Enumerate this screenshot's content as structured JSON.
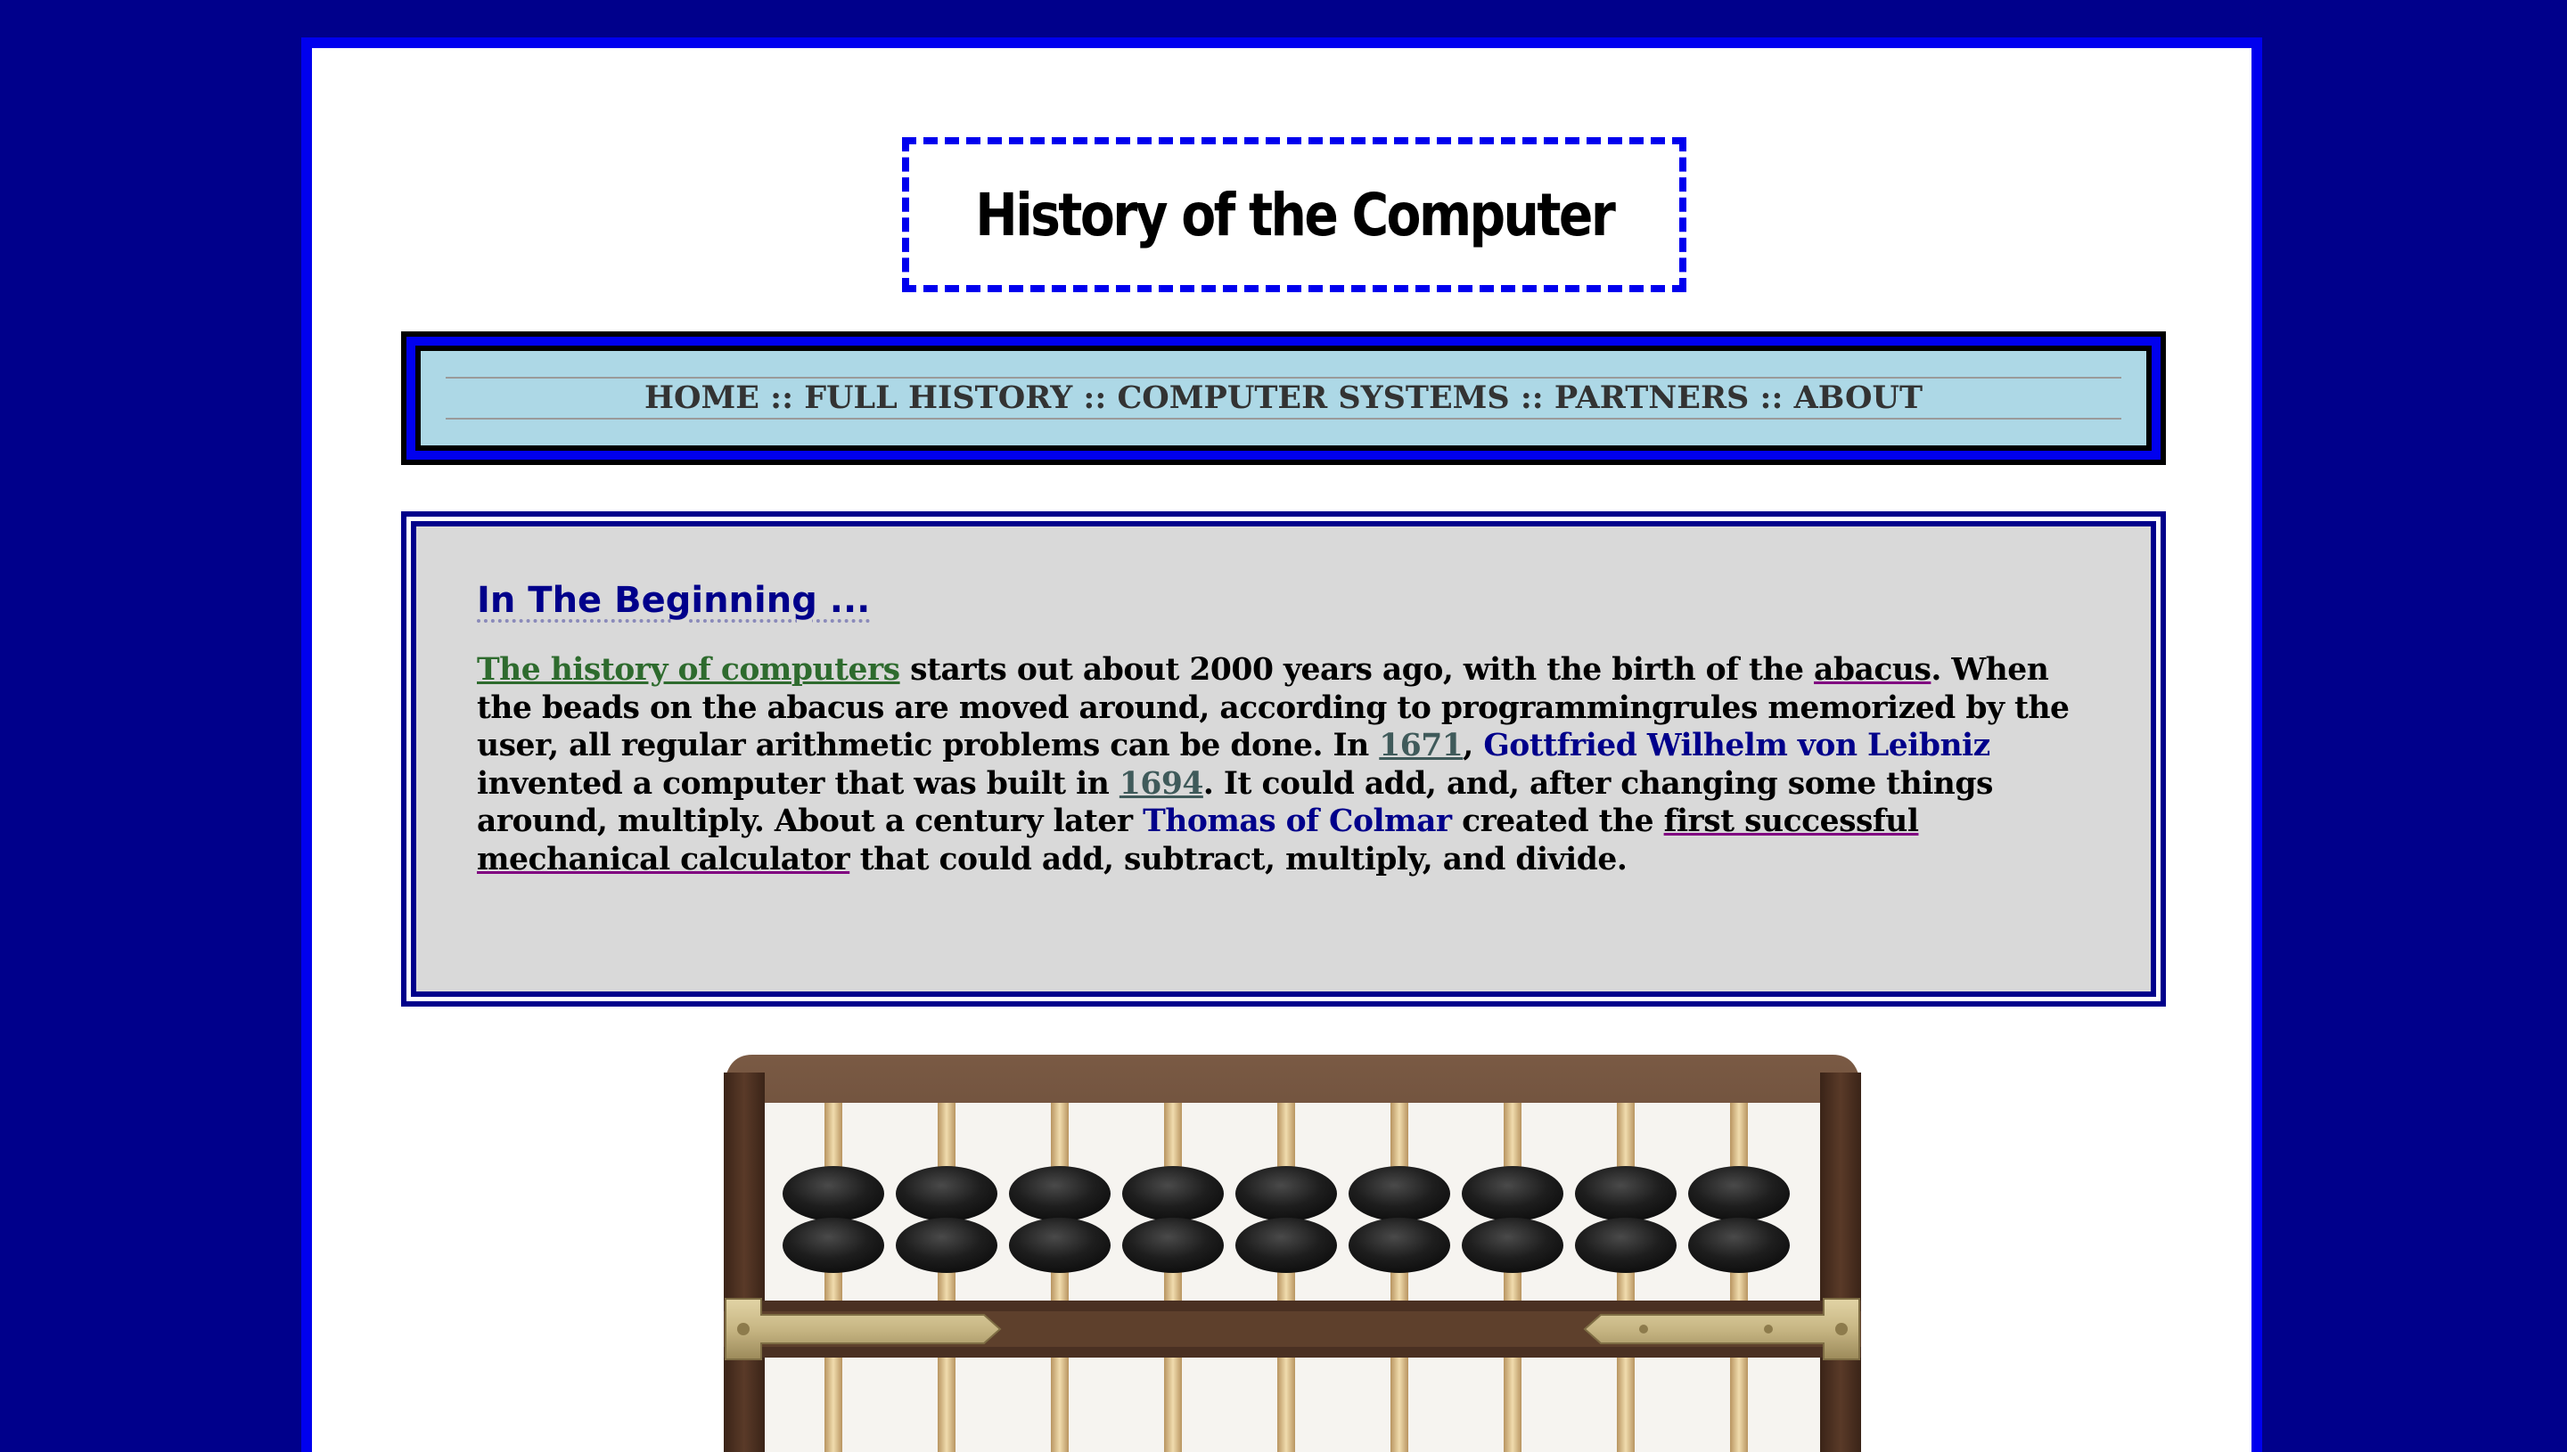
{
  "header": {
    "title": "History of the Computer"
  },
  "nav": {
    "items": [
      {
        "label": "HOME"
      },
      {
        "label": "FULL HISTORY"
      },
      {
        "label": "COMPUTER SYSTEMS"
      },
      {
        "label": "PARTNERS"
      },
      {
        "label": "ABOUT"
      }
    ],
    "separator": "::"
  },
  "main": {
    "heading": "In The Beginning ...",
    "paragraph": {
      "link_history": "The history of computers",
      "t1": " starts out about 2000 years ago, with the birth of the ",
      "link_abacus": "abacus",
      "t2": ". When the beads on the abacus are moved around, according to programmingrules memorized by the user, all regular arithmetic problems can be done. In ",
      "link_1671": "1671",
      "t3": ", ",
      "name_leibniz": "Gottfried Wilhelm von Leibniz",
      "t4": " invented a computer that was built in ",
      "link_1694": "1694",
      "t5": ". It could add, and, after changing some things around, multiply. About a century later ",
      "name_thomas": "Thomas of Colmar",
      "t6": " created the ",
      "link_calculator": "first successful mechanical calculator",
      "t7": " that could add, subtract, multiply, and divide."
    }
  },
  "image": {
    "subject": "abacus-photo",
    "colors": {
      "frame": "#4a3022",
      "bead": "#1e1e1e",
      "rod": "#d8b98a",
      "brass": "#c9b98c"
    }
  }
}
